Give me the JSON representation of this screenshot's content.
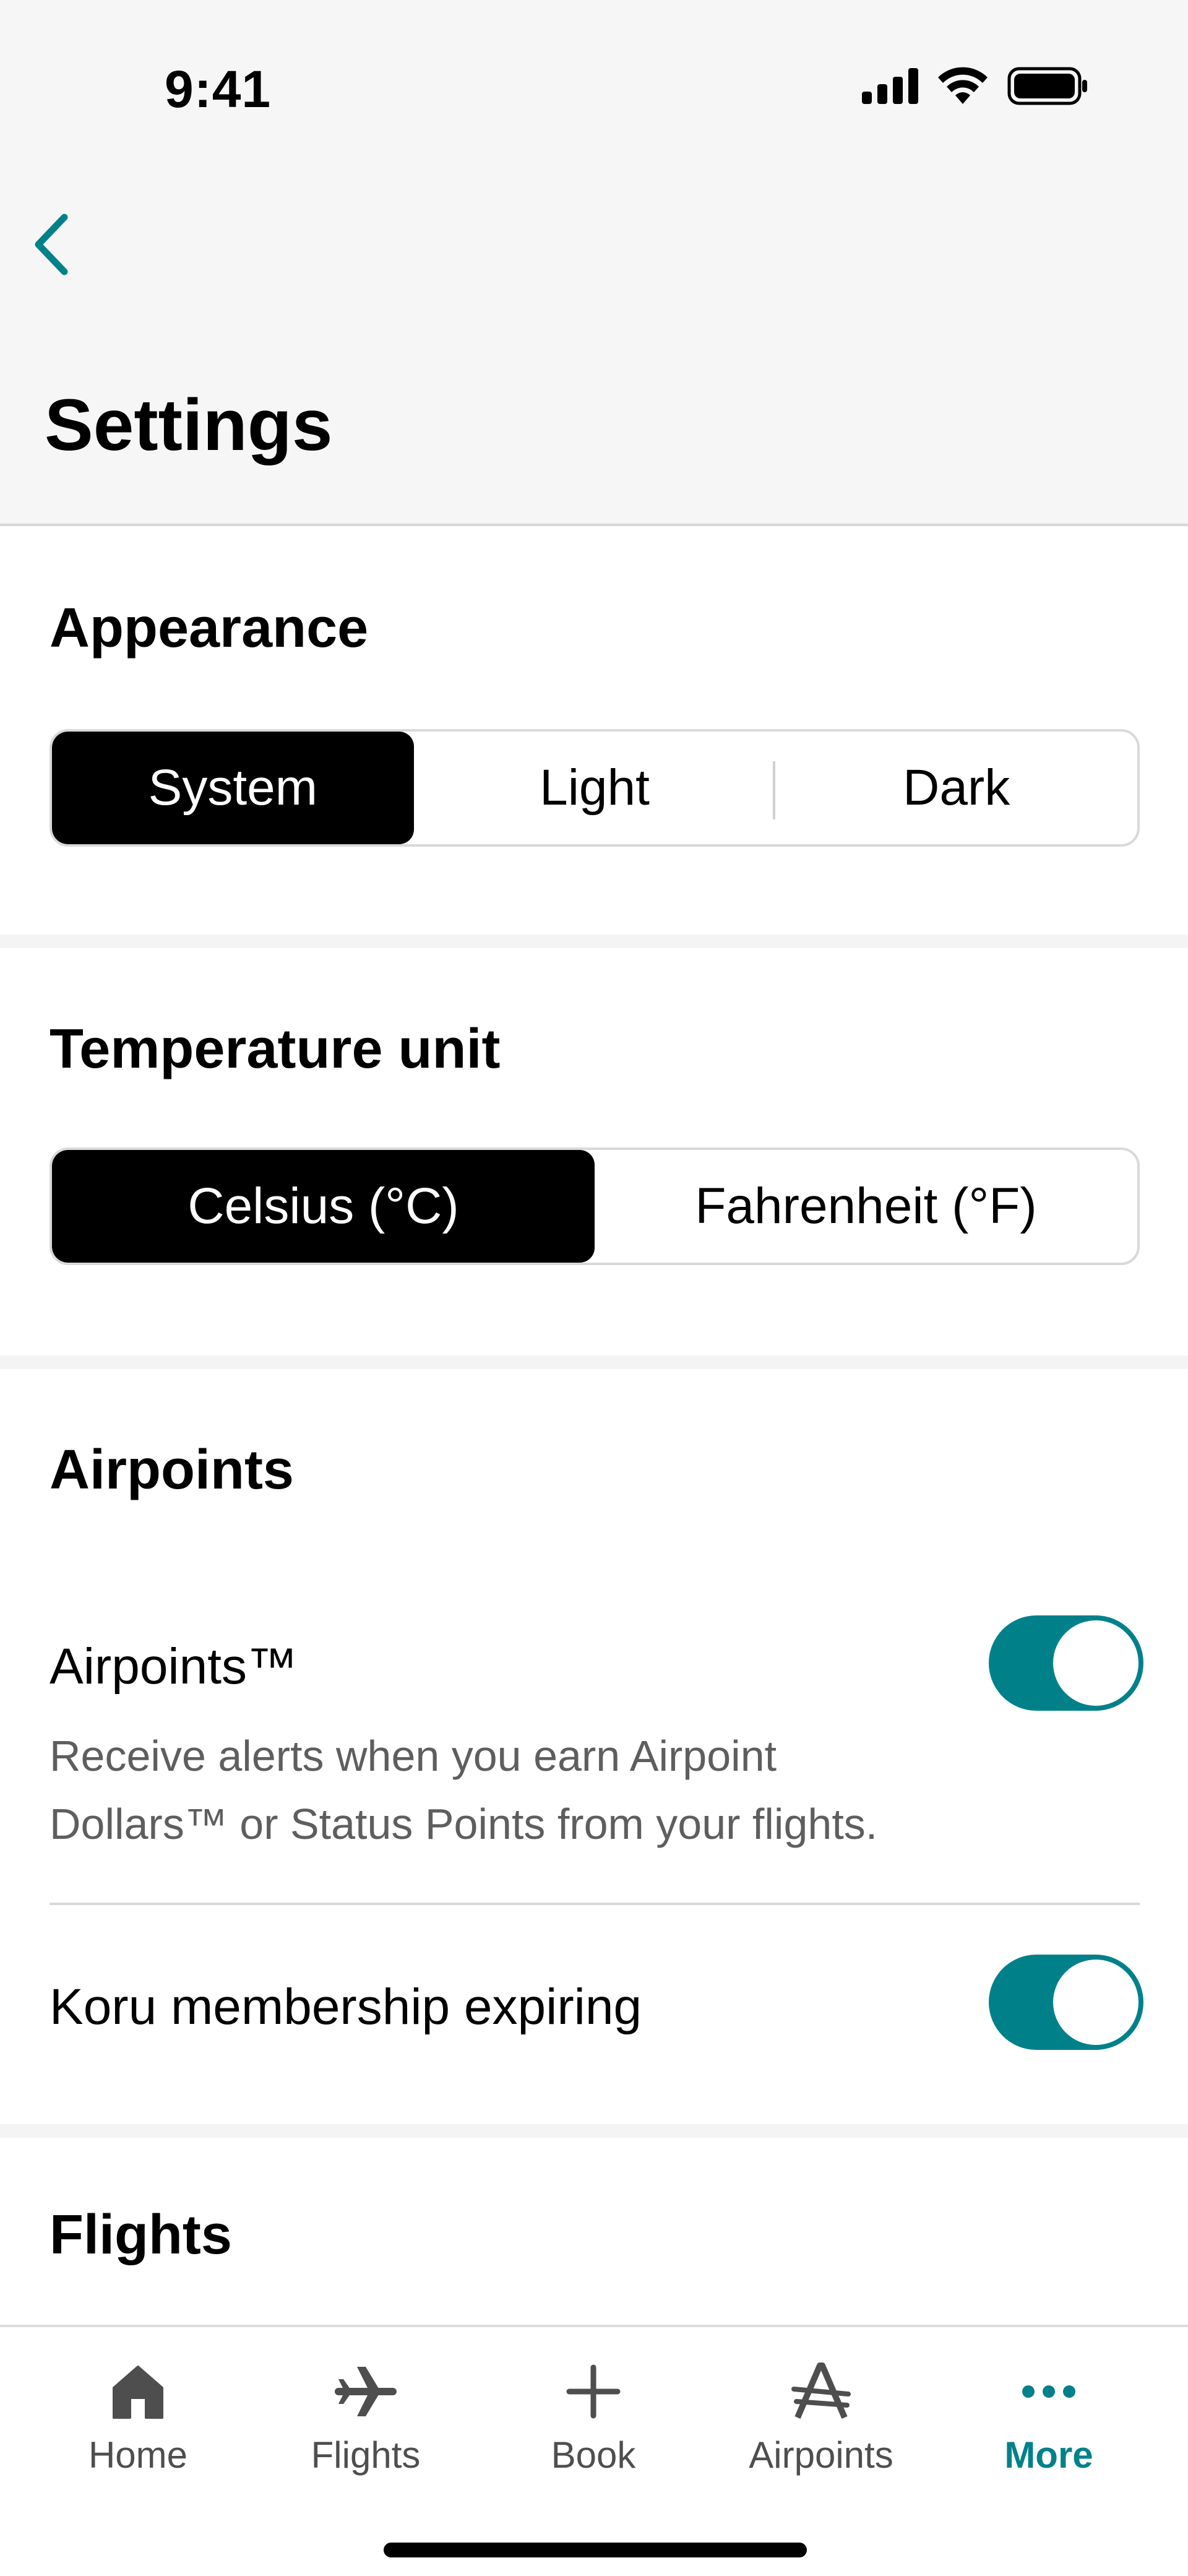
{
  "status_bar": {
    "time": "9:41"
  },
  "header": {
    "title": "Settings"
  },
  "appearance": {
    "title": "Appearance",
    "options": [
      "System",
      "Light",
      "Dark"
    ],
    "selected": "System"
  },
  "temperature": {
    "title": "Temperature unit",
    "options": [
      "Celsius (°C)",
      "Fahrenheit (°F)"
    ],
    "selected": "Celsius (°C)"
  },
  "airpoints": {
    "title": "Airpoints",
    "items": [
      {
        "label": "Airpoints™",
        "description": "Receive alerts when you earn Airpoint Dollars™ or Status Points from your flights.",
        "enabled": true
      },
      {
        "label": "Koru membership expiring",
        "enabled": true
      }
    ]
  },
  "flights": {
    "title": "Flights"
  },
  "tabbar": {
    "items": [
      {
        "label": "Home",
        "icon": "home-icon"
      },
      {
        "label": "Flights",
        "icon": "plane-icon"
      },
      {
        "label": "Book",
        "icon": "plus-icon"
      },
      {
        "label": "Airpoints",
        "icon": "airpoints-icon"
      },
      {
        "label": "More",
        "icon": "more-icon"
      }
    ],
    "active": "More"
  },
  "colors": {
    "accent": "#00818a",
    "selected_segment": "#000000",
    "header_bg": "#f6f6f6"
  }
}
